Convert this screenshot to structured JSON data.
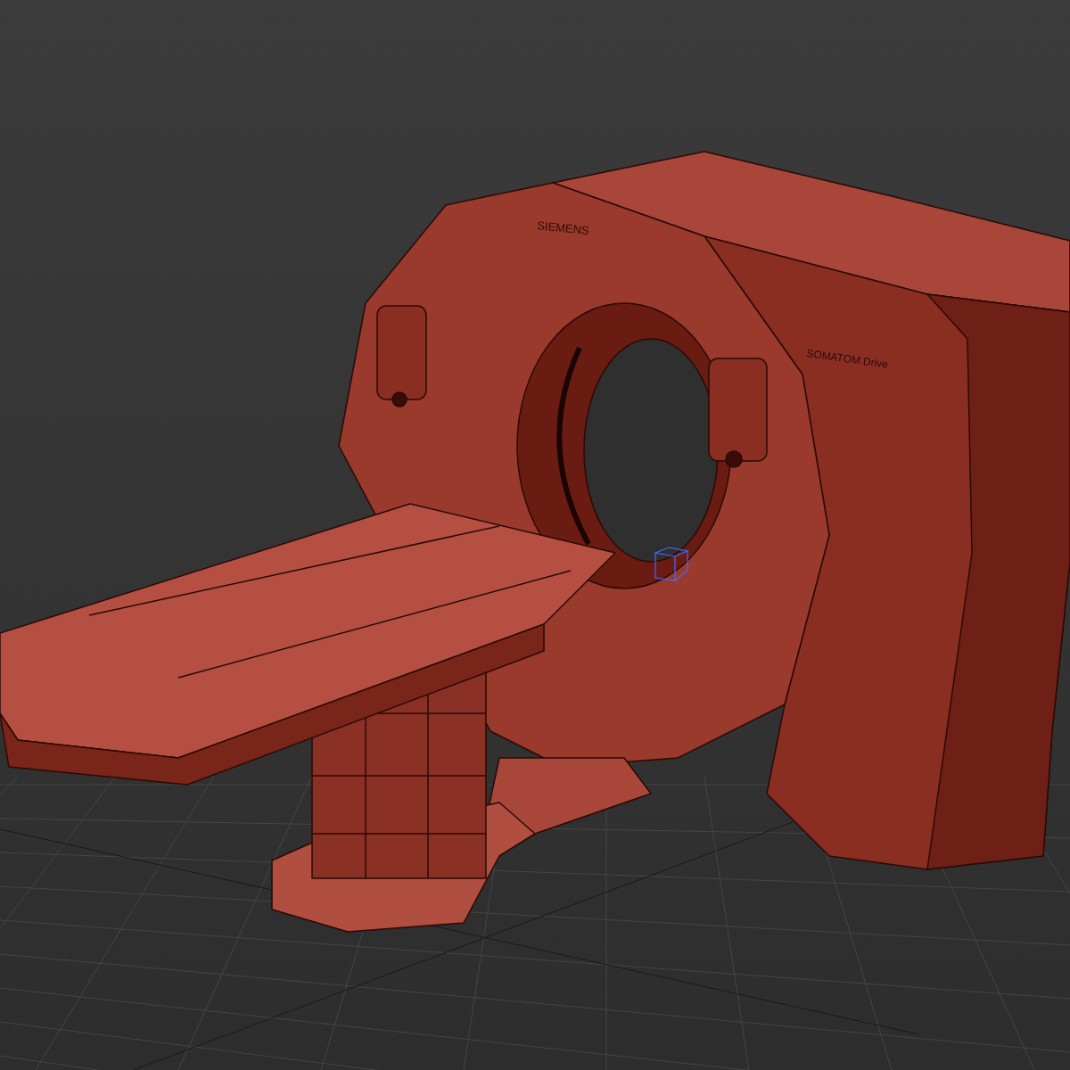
{
  "viewport": {
    "model_labels": [
      {
        "text": "SIEMENS"
      },
      {
        "text": "SOMATOM Drive"
      }
    ]
  }
}
